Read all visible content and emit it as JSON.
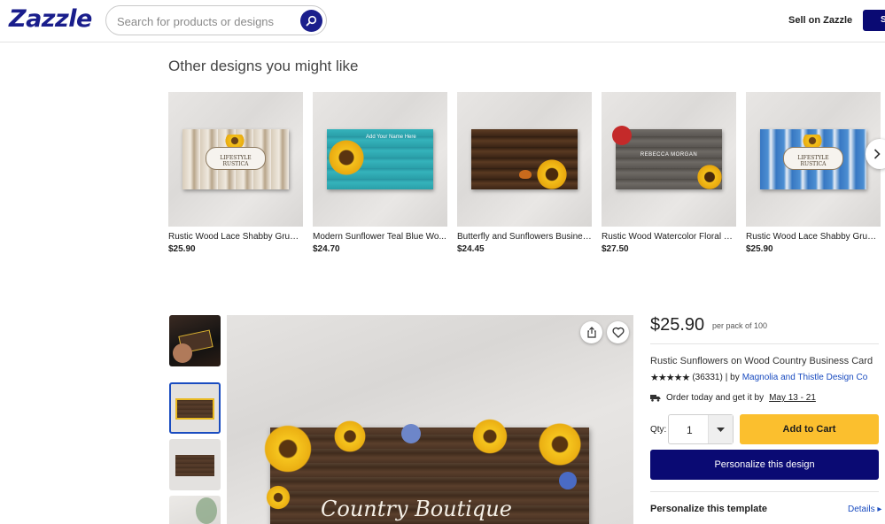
{
  "header": {
    "logo": "Zazzle",
    "search_placeholder": "Search for products or designs",
    "sell_link": "Sell on Zazzle",
    "button_label": "S"
  },
  "related": {
    "title": "Other designs you might like",
    "items": [
      {
        "title": "Rustic Wood Lace Shabby Grung...",
        "price": "$25.90",
        "card_label": "LIFESTYLE RUSTICA",
        "card_color": "#c9b9a2"
      },
      {
        "title": "Modern Sunflower Teal Blue Wo...",
        "price": "$24.70",
        "card_label": "Add Your Name Here",
        "card_color": "#2fa7b0"
      },
      {
        "title": "Butterfly and Sunflowers Busines...",
        "price": "$24.45",
        "card_label": "",
        "card_color": "#4a2f1c"
      },
      {
        "title": "Rustic Wood Watercolor Floral R...",
        "price": "$27.50",
        "card_label": "REBECCA MORGAN",
        "card_color": "#5e5a55"
      },
      {
        "title": "Rustic Wood Lace Shabby Grung...",
        "price": "$25.90",
        "card_label": "LIFESTYLE RUSTICA",
        "card_color": "#3a7bc4"
      }
    ]
  },
  "product": {
    "image_text": "Country Boutique",
    "price": "$25.90",
    "price_note": "per pack of 100",
    "title": "Rustic Sunflowers on Wood Country Business Card",
    "stars": "★★★★★",
    "review_count": "(36331)",
    "by_label": "| by",
    "seller": "Magnolia and Thistle Design Co",
    "ship_text": "Order today and get it by",
    "ship_date": "May 13 - 21",
    "qty_label": "Qty:",
    "qty_value": "1",
    "add_to_cart": "Add to Cart",
    "personalize": "Personalize this design",
    "template_title": "Personalize this template",
    "details": "Details ▸"
  },
  "colors": {
    "brand_navy": "#0a0a73",
    "cart_yellow": "#fbbf2e",
    "link_blue": "#1a4cc0"
  }
}
